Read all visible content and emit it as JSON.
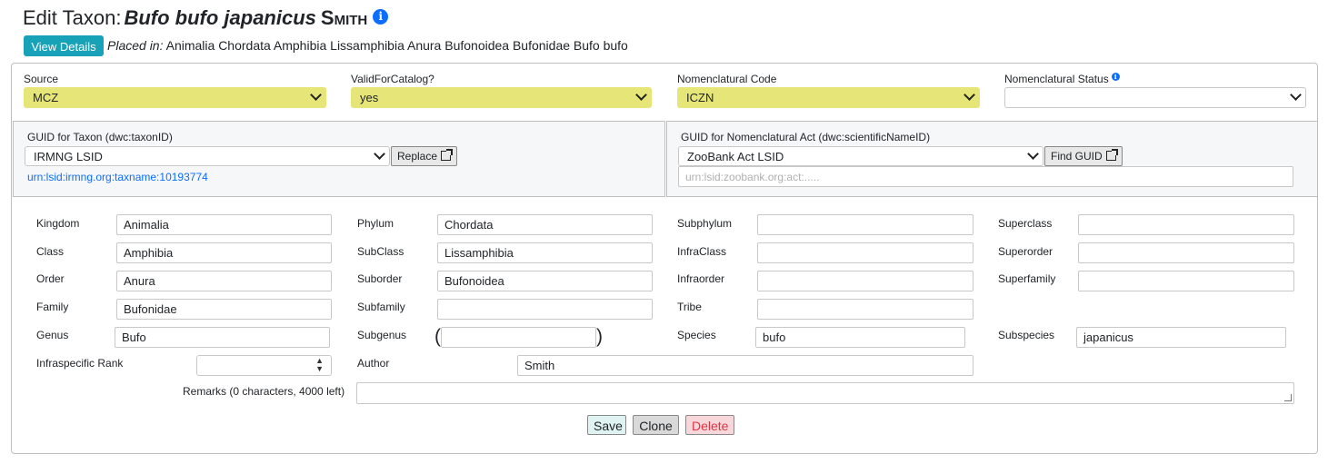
{
  "header": {
    "prefix": "Edit Taxon:",
    "scientific_name": "Bufo bufo japanicus",
    "author": "Smith",
    "info_glyph": "i",
    "view_details_label": "View Details",
    "placed_in_label": "Placed in:",
    "placed_in_path": "Animalia Chordata Amphibia Lissamphibia Anura Bufonoidea Bufonidae Bufo bufo"
  },
  "top_fields": {
    "source": {
      "label": "Source",
      "value": "MCZ"
    },
    "valid_for_catalog": {
      "label": "ValidForCatalog?",
      "value": "yes"
    },
    "nomenclatural_code": {
      "label": "Nomenclatural Code",
      "value": "ICZN"
    },
    "nomenclatural_status": {
      "label": "Nomenclatural Status",
      "value": "",
      "info_glyph": "i"
    }
  },
  "guid_taxon": {
    "label": "GUID for Taxon (dwc:taxonID)",
    "type_value": "IRMNG LSID",
    "button_label": "Replace",
    "link": "urn:lsid:irmng.org:taxname:10193774"
  },
  "guid_nomenclatural_act": {
    "label": "GUID for Nomenclatural Act (dwc:scientificNameID)",
    "type_value": "ZooBank Act LSID",
    "button_label": "Find GUID",
    "placeholder": "urn:lsid:zoobank.org:act:....."
  },
  "ranks": {
    "kingdom": {
      "label": "Kingdom",
      "value": "Animalia"
    },
    "phylum": {
      "label": "Phylum",
      "value": "Chordata"
    },
    "subphylum": {
      "label": "Subphylum",
      "value": ""
    },
    "superclass": {
      "label": "Superclass",
      "value": ""
    },
    "class": {
      "label": "Class",
      "value": "Amphibia"
    },
    "subclass": {
      "label": "SubClass",
      "value": "Lissamphibia"
    },
    "infraclass": {
      "label": "InfraClass",
      "value": ""
    },
    "superorder": {
      "label": "Superorder",
      "value": ""
    },
    "order": {
      "label": "Order",
      "value": "Anura"
    },
    "suborder": {
      "label": "Suborder",
      "value": "Bufonoidea"
    },
    "infraorder": {
      "label": "Infraorder",
      "value": ""
    },
    "superfamily": {
      "label": "Superfamily",
      "value": ""
    },
    "family": {
      "label": "Family",
      "value": "Bufonidae"
    },
    "subfamily": {
      "label": "Subfamily",
      "value": ""
    },
    "tribe": {
      "label": "Tribe",
      "value": ""
    },
    "genus": {
      "label": "Genus",
      "value": "Bufo"
    },
    "subgenus": {
      "label": "Subgenus",
      "value": "",
      "open_paren": "(",
      "close_paren": ")"
    },
    "species": {
      "label": "Species",
      "value": "bufo"
    },
    "subspecies": {
      "label": "Subspecies",
      "value": "japanicus"
    },
    "infraspecific_rank": {
      "label": "Infraspecific Rank",
      "value": ""
    },
    "author": {
      "label": "Author",
      "value": "Smith"
    },
    "remarks": {
      "label": "Remarks (0 characters, 4000 left)",
      "value": ""
    }
  },
  "actions": {
    "save": "Save",
    "clone": "Clone",
    "delete": "Delete"
  },
  "colors": {
    "required_field_bg": "#e6e678",
    "view_details_bg": "#17a2b8",
    "info_icon": "#0d6efd",
    "save_bg": "#dff3f3",
    "clone_bg": "#d9d9d9",
    "delete_bg": "#f8d7da",
    "delete_text": "#dc3545"
  }
}
